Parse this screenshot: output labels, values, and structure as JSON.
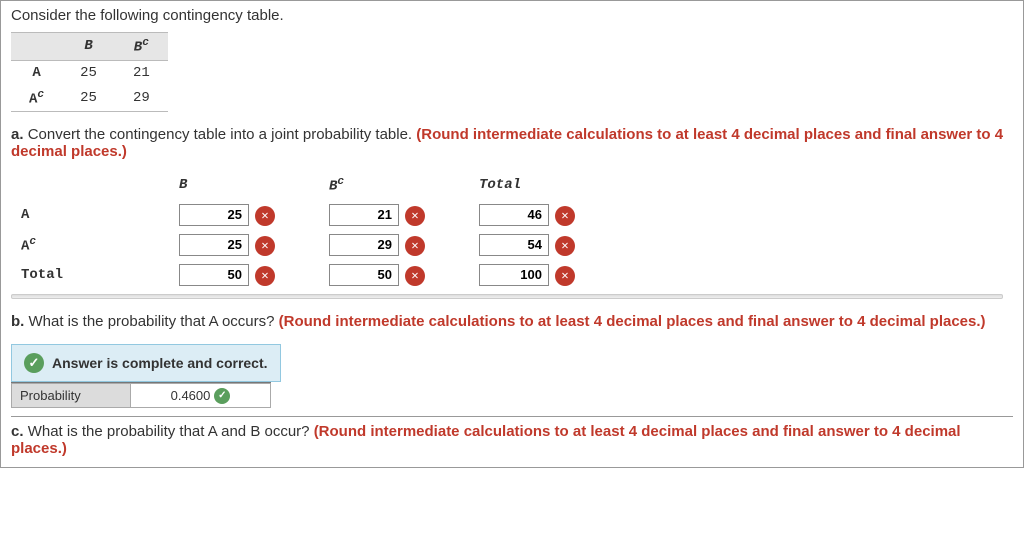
{
  "intro": "Consider the following contingency table.",
  "ctable": {
    "col_b": "B",
    "col_bc_base": "B",
    "row_a": "A",
    "row_ac_base": "A",
    "r1c1": "25",
    "r1c2": "21",
    "r2c1": "25",
    "r2c2": "29"
  },
  "partA": {
    "prefix": "a. ",
    "text": "Convert the contingency table into a joint probability table. ",
    "red": "(Round intermediate calculations to at least 4 decimal places and final answer to 4 decimal places.)"
  },
  "ptable": {
    "hdr_b": "B",
    "hdr_bc_base": "B",
    "hdr_total": "Total",
    "row_a": "A",
    "row_ac_base": "A",
    "row_total": "Total",
    "cells": {
      "r1c1": "25",
      "r1c2": "21",
      "r1c3": "46",
      "r2c1": "25",
      "r2c2": "29",
      "r2c3": "54",
      "r3c1": "50",
      "r3c2": "50",
      "r3c3": "100"
    }
  },
  "partB": {
    "prefix": "b. ",
    "text": "What is the probability that A occurs? ",
    "red": "(Round intermediate calculations to at least 4 decimal places and final answer to 4 decimal places.)",
    "banner": "Answer is complete and correct.",
    "probLabel": "Probability",
    "probValue": "0.4600"
  },
  "partC": {
    "prefix": "c. ",
    "text": "What is the probability that A and B occur? ",
    "red": "(Round intermediate calculations to at least 4 decimal places and final answer to 4 decimal places.)"
  },
  "icons": {
    "wrong": "✕",
    "correct": "✓"
  }
}
